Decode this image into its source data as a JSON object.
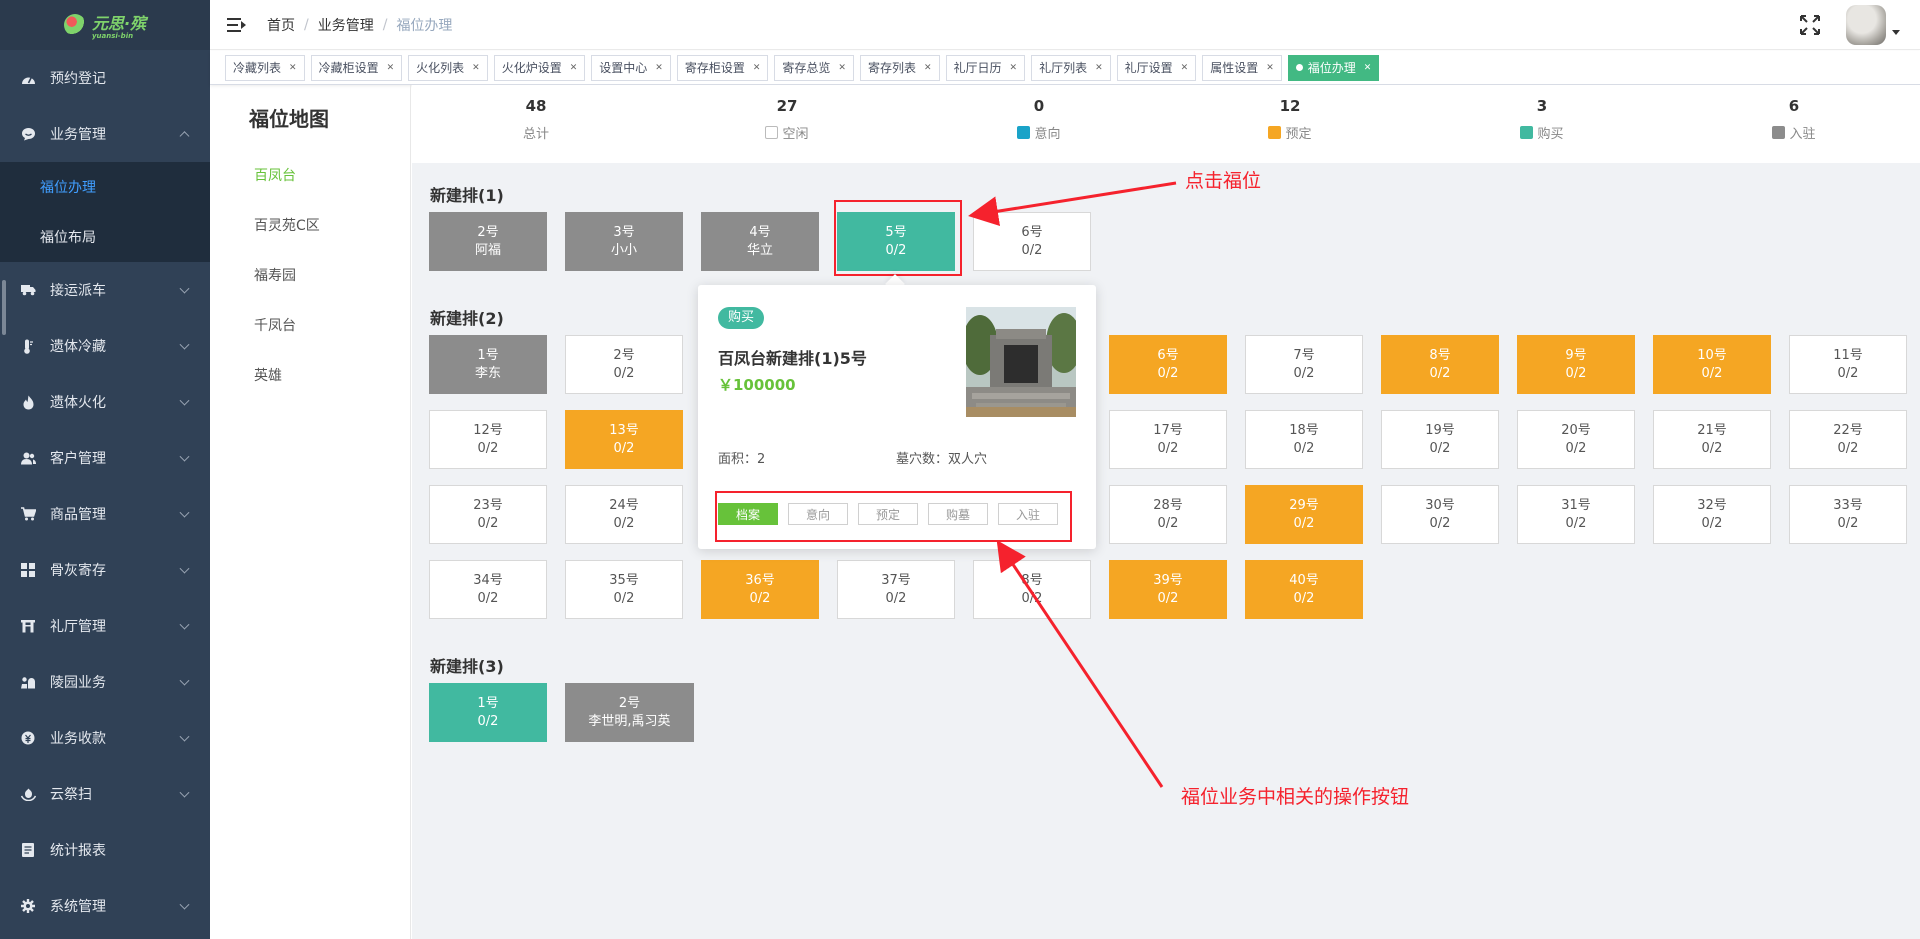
{
  "logo": {
    "text": "元思·殡",
    "sub": "yuansi-bin"
  },
  "sidebar": {
    "items": [
      {
        "label": "预约登记",
        "icon": "dashboard-icon"
      },
      {
        "label": "业务管理",
        "icon": "chat-icon",
        "expanded": true
      },
      {
        "label": "接运派车",
        "icon": "truck-icon"
      },
      {
        "label": "遗体冷藏",
        "icon": "thermometer-icon"
      },
      {
        "label": "遗体火化",
        "icon": "fire-icon"
      },
      {
        "label": "客户管理",
        "icon": "users-icon"
      },
      {
        "label": "商品管理",
        "icon": "cart-icon"
      },
      {
        "label": "骨灰寄存",
        "icon": "grid-icon"
      },
      {
        "label": "礼厅管理",
        "icon": "hall-icon"
      },
      {
        "label": "陵园业务",
        "icon": "cemetery-icon"
      },
      {
        "label": "业务收款",
        "icon": "payment-icon"
      },
      {
        "label": "云祭扫",
        "icon": "cloud-icon"
      },
      {
        "label": "统计报表",
        "icon": "report-icon"
      },
      {
        "label": "系统管理",
        "icon": "gear-icon"
      }
    ],
    "sub_items": [
      {
        "label": "福位办理",
        "active": true
      },
      {
        "label": "福位布局",
        "active": false
      }
    ]
  },
  "breadcrumb": [
    "首页",
    "业务管理",
    "福位办理"
  ],
  "tags": [
    {
      "label": "冷藏列表"
    },
    {
      "label": "冷藏柜设置"
    },
    {
      "label": "火化列表"
    },
    {
      "label": "火化炉设置"
    },
    {
      "label": "设置中心"
    },
    {
      "label": "寄存柜设置"
    },
    {
      "label": "寄存总览"
    },
    {
      "label": "寄存列表"
    },
    {
      "label": "礼厅日历"
    },
    {
      "label": "礼厅列表"
    },
    {
      "label": "礼厅设置"
    },
    {
      "label": "属性设置"
    },
    {
      "label": "福位办理",
      "active": true
    }
  ],
  "area_panel": {
    "title": "福位地图",
    "areas": [
      {
        "label": "百凤台",
        "active": true
      },
      {
        "label": "百灵苑C区"
      },
      {
        "label": "福寿园"
      },
      {
        "label": "千凤台"
      },
      {
        "label": "英雄"
      }
    ]
  },
  "stats": [
    {
      "num": "48",
      "label": "总计",
      "color": ""
    },
    {
      "num": "27",
      "label": "空闲",
      "color": "#ffffff"
    },
    {
      "num": "0",
      "label": "意向",
      "color": "#1aa3c8"
    },
    {
      "num": "12",
      "label": "预定",
      "color": "#f5a623"
    },
    {
      "num": "3",
      "label": "购买",
      "color": "#41b9a0"
    },
    {
      "num": "6",
      "label": "入驻",
      "color": "#8c8c8c"
    }
  ],
  "rows": [
    {
      "title": "新建排(1)",
      "cells": [
        {
          "no": "2号",
          "sub": "阿福",
          "status": "occupied"
        },
        {
          "no": "3号",
          "sub": "小小",
          "status": "occupied"
        },
        {
          "no": "4号",
          "sub": "华立",
          "status": "occupied"
        },
        {
          "no": "5号",
          "sub": "0/2",
          "status": "purchased"
        },
        {
          "no": "6号",
          "sub": "0/2",
          "status": "free"
        }
      ]
    },
    {
      "title": "新建排(2)",
      "cells": [
        {
          "no": "1号",
          "sub": "李东",
          "status": "occupied"
        },
        {
          "no": "2号",
          "sub": "0/2",
          "status": "free"
        },
        {
          "no": "6号",
          "sub": "0/2",
          "status": "reserved"
        },
        {
          "no": "7号",
          "sub": "0/2",
          "status": "free"
        },
        {
          "no": "8号",
          "sub": "0/2",
          "status": "reserved"
        },
        {
          "no": "9号",
          "sub": "0/2",
          "status": "reserved"
        },
        {
          "no": "10号",
          "sub": "0/2",
          "status": "reserved"
        },
        {
          "no": "11号",
          "sub": "0/2",
          "status": "free"
        },
        {
          "no": "12号",
          "sub": "0/2",
          "status": "free"
        },
        {
          "no": "13号",
          "sub": "0/2",
          "status": "reserved"
        },
        {
          "no": "17号",
          "sub": "0/2",
          "status": "free"
        },
        {
          "no": "18号",
          "sub": "0/2",
          "status": "free"
        },
        {
          "no": "19号",
          "sub": "0/2",
          "status": "free"
        },
        {
          "no": "20号",
          "sub": "0/2",
          "status": "free"
        },
        {
          "no": "21号",
          "sub": "0/2",
          "status": "free"
        },
        {
          "no": "22号",
          "sub": "0/2",
          "status": "free"
        },
        {
          "no": "23号",
          "sub": "0/2",
          "status": "free"
        },
        {
          "no": "24号",
          "sub": "0/2",
          "status": "free"
        },
        {
          "no": "28号",
          "sub": "0/2",
          "status": "free"
        },
        {
          "no": "29号",
          "sub": "0/2",
          "status": "reserved"
        },
        {
          "no": "30号",
          "sub": "0/2",
          "status": "free"
        },
        {
          "no": "31号",
          "sub": "0/2",
          "status": "free"
        },
        {
          "no": "32号",
          "sub": "0/2",
          "status": "free"
        },
        {
          "no": "33号",
          "sub": "0/2",
          "status": "free"
        },
        {
          "no": "34号",
          "sub": "0/2",
          "status": "free"
        },
        {
          "no": "35号",
          "sub": "0/2",
          "status": "free"
        },
        {
          "no": "36号",
          "sub": "0/2",
          "status": "reserved"
        },
        {
          "no": "37号",
          "sub": "0/2",
          "status": "free"
        },
        {
          "no": "8号",
          "sub": "0/2",
          "status": "free"
        },
        {
          "no": "39号",
          "sub": "0/2",
          "status": "reserved"
        },
        {
          "no": "40号",
          "sub": "0/2",
          "status": "reserved"
        }
      ]
    },
    {
      "title": "新建排(3)",
      "cells": [
        {
          "no": "1号",
          "sub": "0/2",
          "status": "purchased"
        },
        {
          "no": "2号",
          "sub": "李世明,禹习英",
          "status": "occupied"
        }
      ]
    }
  ],
  "popover": {
    "badge": "购买",
    "title": "百凤台新建排(1)5号",
    "price": "￥100000",
    "area_label": "面积：2",
    "type_label": "墓穴数：双人穴",
    "actions": [
      {
        "label": "档案",
        "primary": true
      },
      {
        "label": "意向"
      },
      {
        "label": "预定"
      },
      {
        "label": "购墓"
      },
      {
        "label": "入驻"
      }
    ]
  },
  "annotations": {
    "click_hint": "点击福位",
    "buttons_hint": "福位业务中相关的操作按钮",
    "color": "#f5222d"
  }
}
